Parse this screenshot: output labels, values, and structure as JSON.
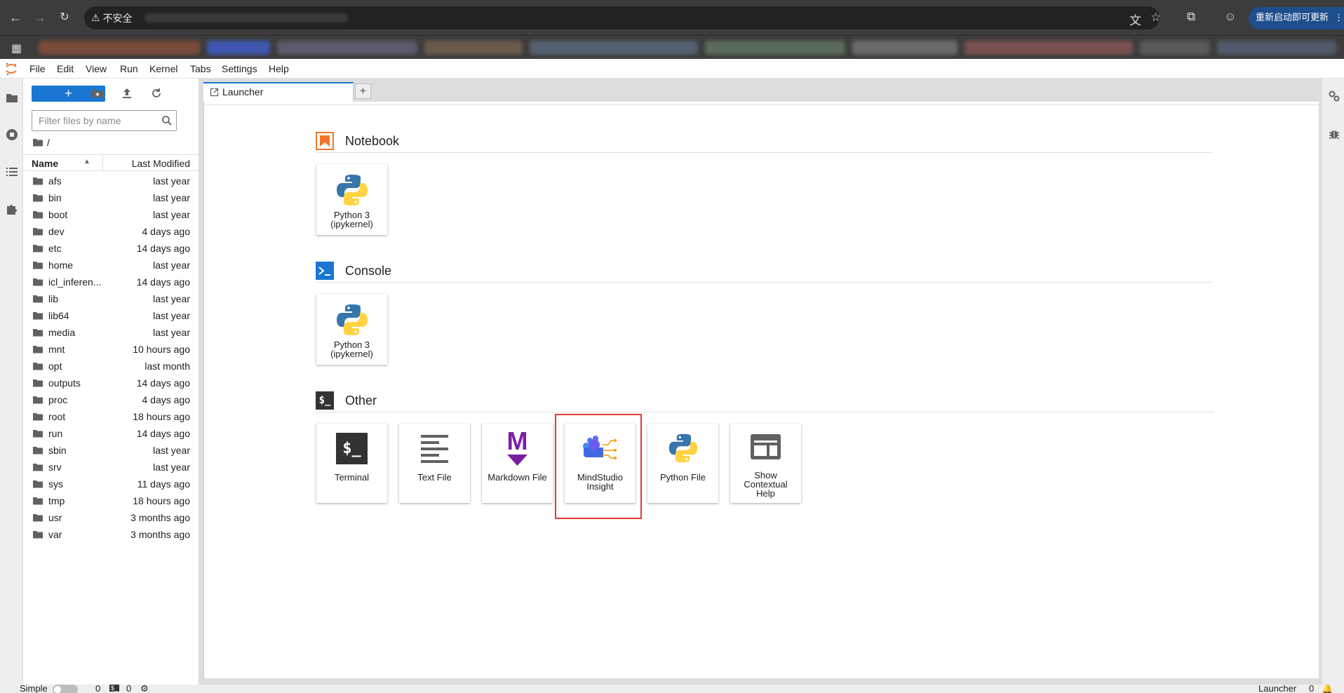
{
  "browser": {
    "security_label": "不安全",
    "update_button": "重新启动即可更新"
  },
  "menubar": {
    "items": [
      "File",
      "Edit",
      "View",
      "Run",
      "Kernel",
      "Tabs",
      "Settings",
      "Help"
    ]
  },
  "filebrowser": {
    "new_button": "+",
    "filter_placeholder": "Filter files by name",
    "breadcrumb": "/",
    "col_name": "Name",
    "col_modified": "Last Modified",
    "files": [
      {
        "name": "afs",
        "modified": "last year"
      },
      {
        "name": "bin",
        "modified": "last year"
      },
      {
        "name": "boot",
        "modified": "last year"
      },
      {
        "name": "dev",
        "modified": "4 days ago"
      },
      {
        "name": "etc",
        "modified": "14 days ago"
      },
      {
        "name": "home",
        "modified": "last year"
      },
      {
        "name": "icl_inferen...",
        "modified": "14 days ago"
      },
      {
        "name": "lib",
        "modified": "last year"
      },
      {
        "name": "lib64",
        "modified": "last year"
      },
      {
        "name": "media",
        "modified": "last year"
      },
      {
        "name": "mnt",
        "modified": "10 hours ago"
      },
      {
        "name": "opt",
        "modified": "last month"
      },
      {
        "name": "outputs",
        "modified": "14 days ago"
      },
      {
        "name": "proc",
        "modified": "4 days ago"
      },
      {
        "name": "root",
        "modified": "18 hours ago"
      },
      {
        "name": "run",
        "modified": "14 days ago"
      },
      {
        "name": "sbin",
        "modified": "last year"
      },
      {
        "name": "srv",
        "modified": "last year"
      },
      {
        "name": "sys",
        "modified": "11 days ago"
      },
      {
        "name": "tmp",
        "modified": "18 hours ago"
      },
      {
        "name": "usr",
        "modified": "3 months ago"
      },
      {
        "name": "var",
        "modified": "3 months ago"
      }
    ]
  },
  "tabs": {
    "launcher_label": "Launcher",
    "add_label": "+"
  },
  "launcher": {
    "notebook": {
      "title": "Notebook",
      "cards": [
        {
          "line1": "Python 3",
          "line2": "(ipykernel)"
        }
      ]
    },
    "console": {
      "title": "Console",
      "cards": [
        {
          "line1": "Python 3",
          "line2": "(ipykernel)"
        }
      ]
    },
    "other": {
      "title": "Other",
      "section_icon_text": "$_",
      "cards": [
        {
          "line1": "Terminal",
          "line2": "",
          "line3": ""
        },
        {
          "line1": "Text File",
          "line2": "",
          "line3": ""
        },
        {
          "line1": "Markdown File",
          "line2": "",
          "line3": ""
        },
        {
          "line1": "MindStudio",
          "line2": "Insight",
          "line3": ""
        },
        {
          "line1": "Python File",
          "line2": "",
          "line3": ""
        },
        {
          "line1": "Show",
          "line2": "Contextual",
          "line3": "Help"
        }
      ],
      "terminal_icon_text": "$_",
      "markdown_icon_text": "M"
    }
  },
  "statusbar": {
    "mode_label": "Simple",
    "terminals_count": "0",
    "kernels_count": "0",
    "right_label": "Launcher",
    "right_count": "0"
  },
  "colors": {
    "accent": "#1976d2",
    "highlight_box": "#e53935",
    "notebook_icon": "#f37626",
    "console_icon": "#1976d2",
    "markdown_icon": "#7b1fa2"
  }
}
